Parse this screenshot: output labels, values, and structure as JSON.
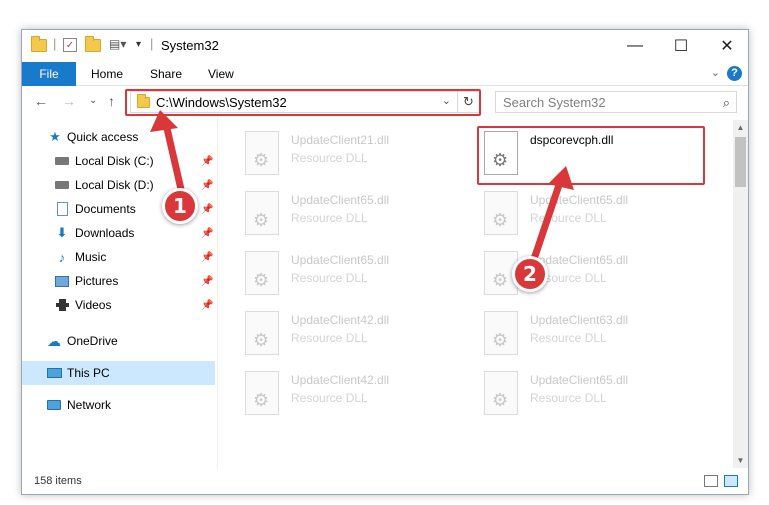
{
  "window": {
    "title": "System32",
    "controls": {
      "minimize": "—",
      "maximize": "☐",
      "close": "✕"
    }
  },
  "ribbon": {
    "file_tab": "File",
    "tabs": [
      "Home",
      "Share",
      "View"
    ],
    "help": "?"
  },
  "address_bar": {
    "path": "C:\\Windows\\System32",
    "search_placeholder": "Search System32"
  },
  "sidebar": {
    "items": [
      {
        "label": "Quick access",
        "icon": "star-icon",
        "pinned": false
      },
      {
        "label": "Local Disk (C:)",
        "icon": "drive-icon",
        "pinned": true
      },
      {
        "label": "Local Disk (D:)",
        "icon": "drive-icon",
        "pinned": true
      },
      {
        "label": "Documents",
        "icon": "documents-icon",
        "pinned": true
      },
      {
        "label": "Downloads",
        "icon": "downloads-icon",
        "pinned": true
      },
      {
        "label": "Music",
        "icon": "music-icon",
        "pinned": true
      },
      {
        "label": "Pictures",
        "icon": "pictures-icon",
        "pinned": true
      },
      {
        "label": "Videos",
        "icon": "videos-icon",
        "pinned": true
      },
      {
        "label": "OneDrive",
        "icon": "cloud-icon",
        "pinned": false
      },
      {
        "label": "This PC",
        "icon": "computer-icon",
        "pinned": false,
        "selected": true
      },
      {
        "label": "Network",
        "icon": "network-icon",
        "pinned": false
      }
    ]
  },
  "files": [
    {
      "name": "UpdateClient21.dll",
      "type": "Resource DLL"
    },
    {
      "name": "dspcorevcph.dll",
      "type": "",
      "active": true
    },
    {
      "name": "UpdateClient65.dll",
      "type": "Resource DLL"
    },
    {
      "name": "UpdateClient65.dll",
      "type": "Resource DLL"
    },
    {
      "name": "UpdateClient65.dll",
      "type": "Resource DLL"
    },
    {
      "name": "UpdateClient65.dll",
      "type": "Resource DLL"
    },
    {
      "name": "UpdateClient42.dll",
      "type": "Resource DLL"
    },
    {
      "name": "UpdateClient63.dll",
      "type": "Resource DLL"
    },
    {
      "name": "UpdateClient42.dll",
      "type": "Resource DLL"
    },
    {
      "name": "UpdateClient65.dll",
      "type": "Resource DLL"
    }
  ],
  "status": {
    "item_count": "158 items"
  },
  "annotations": {
    "step1": "1",
    "step2": "2",
    "color": "#d9373a"
  }
}
